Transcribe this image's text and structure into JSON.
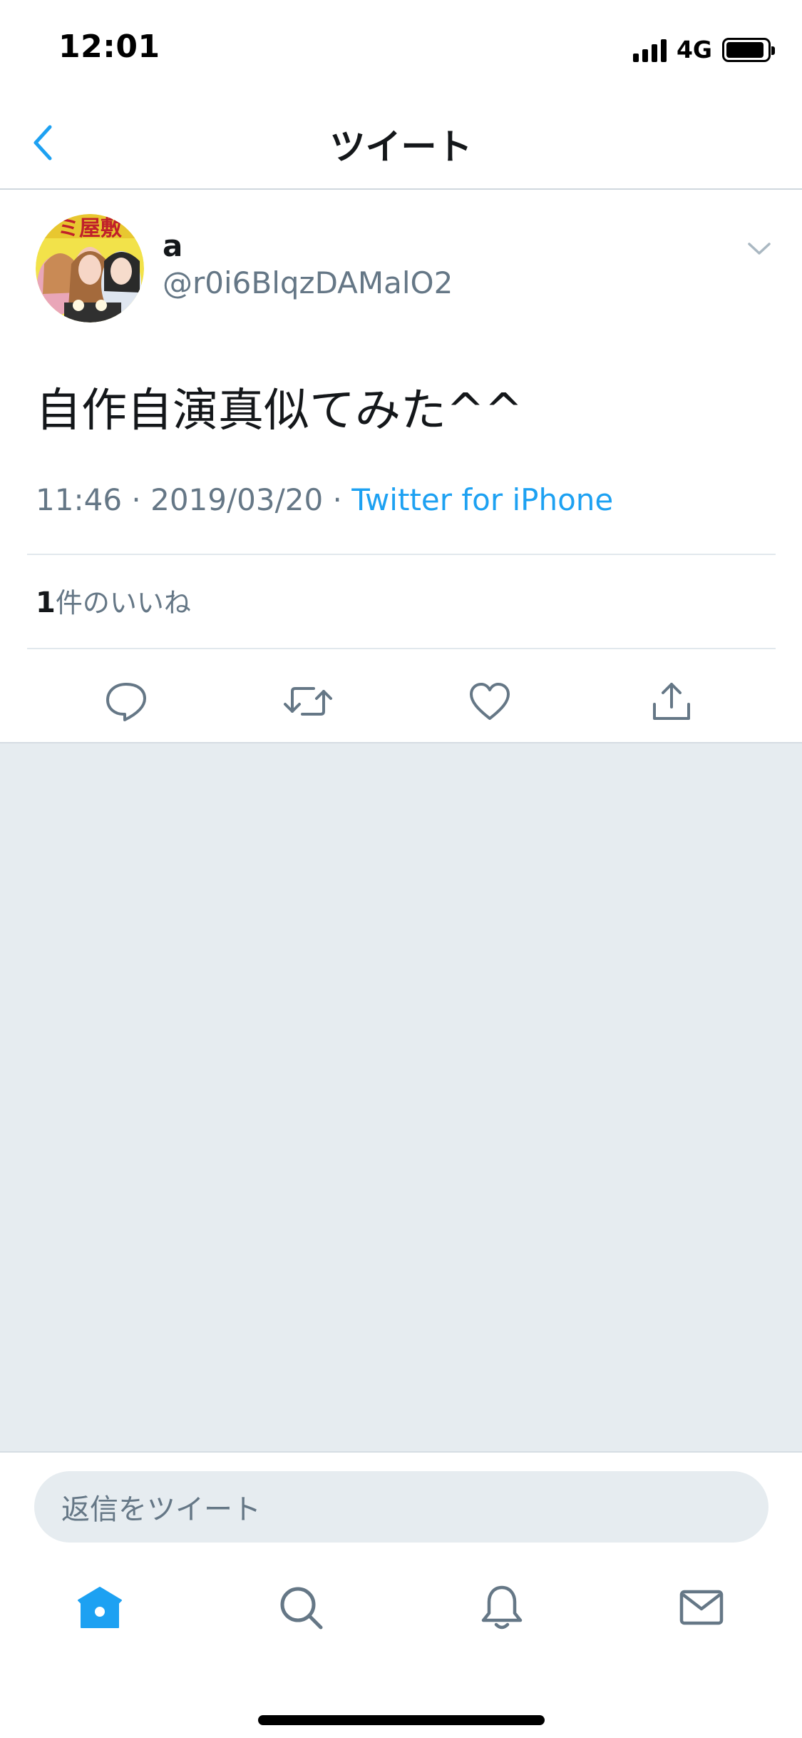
{
  "status_bar": {
    "time": "12:01",
    "network": "4G",
    "icons": [
      "signal-icon",
      "battery-icon"
    ]
  },
  "nav": {
    "title": "ツイート",
    "back_icon": "chevron-left-icon"
  },
  "tweet": {
    "author_name": "a",
    "author_handle": "@r0i6BlqzDAMalO2",
    "text": "自作自演真似てみた^^",
    "time": "11:46",
    "date": "2019/03/20",
    "separator": " · ",
    "source": "Twitter for iPhone",
    "likes_count": "1",
    "likes_label": "件のいいね",
    "avatar_text": "ミ屋敷",
    "menu_icon": "chevron-down-icon",
    "actions": [
      {
        "name": "reply",
        "icon": "reply-icon"
      },
      {
        "name": "retweet",
        "icon": "retweet-icon"
      },
      {
        "name": "like",
        "icon": "heart-icon"
      },
      {
        "name": "share",
        "icon": "share-icon"
      }
    ]
  },
  "reply": {
    "placeholder": "返信をツイート"
  },
  "tab_bar": {
    "items": [
      {
        "name": "home",
        "icon": "home-icon",
        "active": true
      },
      {
        "name": "search",
        "icon": "search-icon",
        "active": false
      },
      {
        "name": "notifications",
        "icon": "bell-icon",
        "active": false
      },
      {
        "name": "messages",
        "icon": "mail-icon",
        "active": false
      }
    ]
  },
  "colors": {
    "accent": "#1da1f2",
    "text_primary": "#14171a",
    "text_secondary": "#657786",
    "background_gray": "#e6ecf0",
    "divider": "#e1e8ed"
  }
}
